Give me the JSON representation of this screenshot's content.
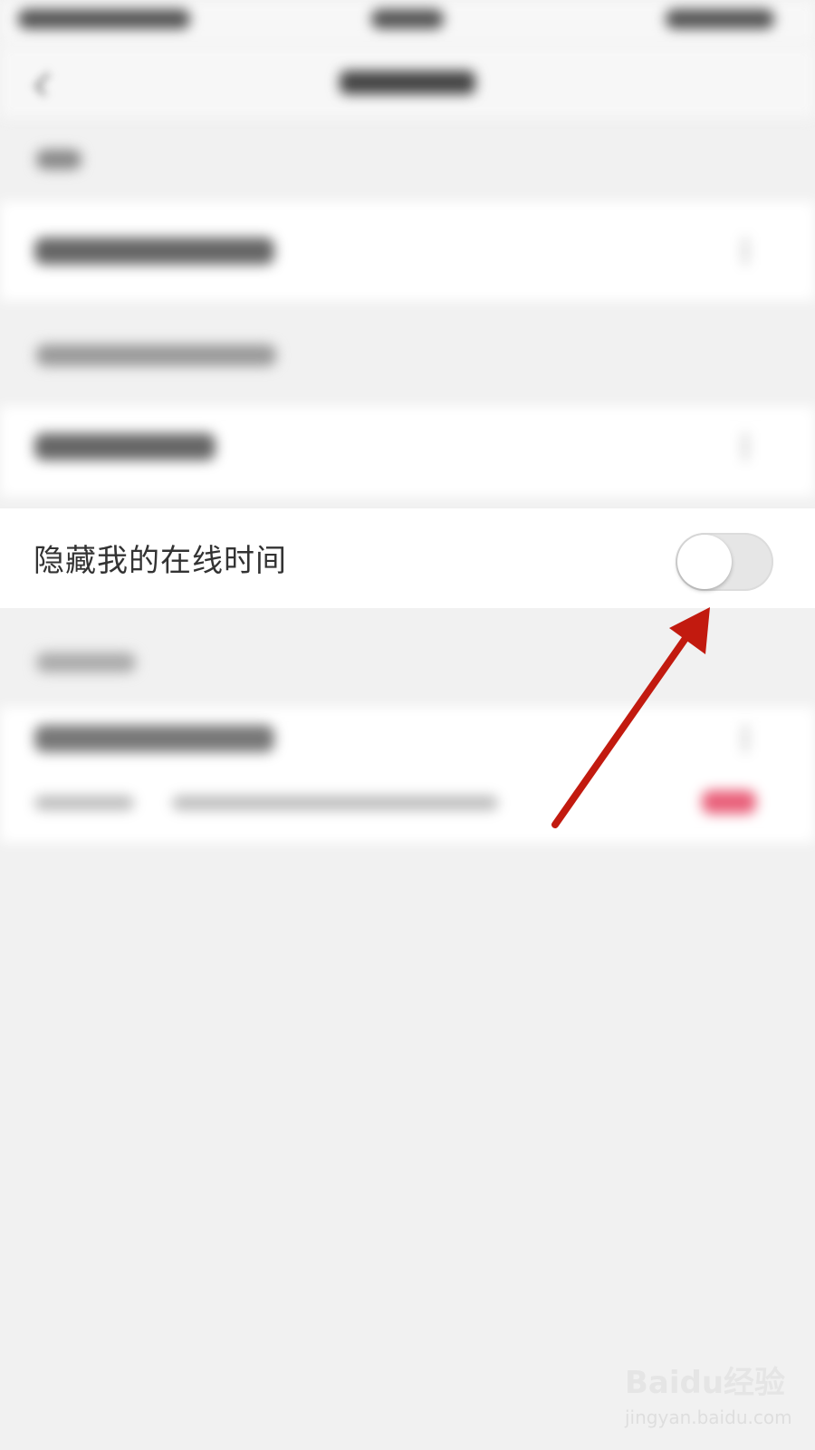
{
  "hide_online_row": {
    "label": "隐藏我的在线时间",
    "toggle_state": "off"
  },
  "annotation": {
    "arrow_color": "#c21a0f"
  },
  "watermark": {
    "logo": "Baidu经验",
    "url": "jingyan.baidu.com"
  }
}
